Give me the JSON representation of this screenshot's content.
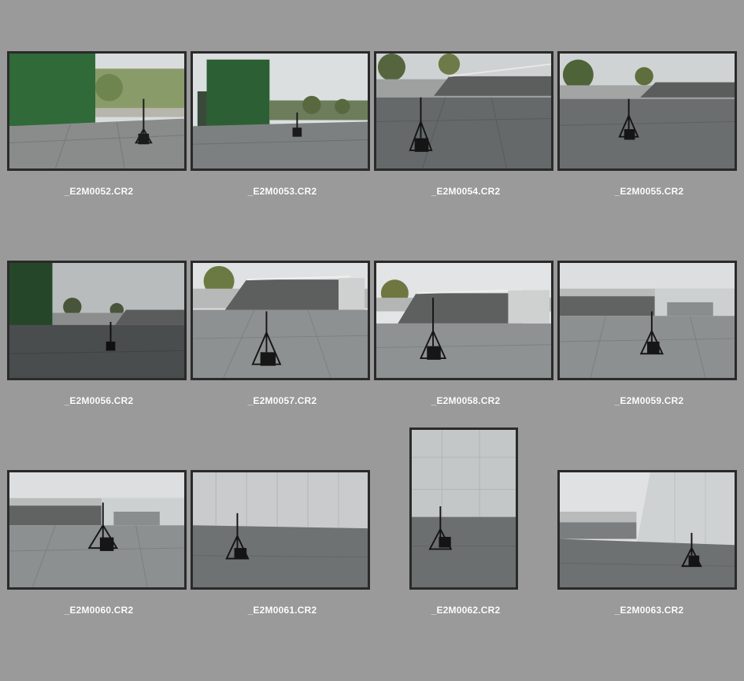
{
  "window": {
    "title": ""
  },
  "thumbnails": [
    {
      "filename": "_E2M0052.CR2",
      "orientation": "landscape",
      "scene": "green-shed"
    },
    {
      "filename": "_E2M0053.CR2",
      "orientation": "landscape",
      "scene": "green-shed"
    },
    {
      "filename": "_E2M0054.CR2",
      "orientation": "landscape",
      "scene": "stairs"
    },
    {
      "filename": "_E2M0055.CR2",
      "orientation": "landscape",
      "scene": "stairs"
    },
    {
      "filename": "_E2M0056.CR2",
      "orientation": "landscape",
      "scene": "green-shed"
    },
    {
      "filename": "_E2M0057.CR2",
      "orientation": "landscape",
      "scene": "stairs"
    },
    {
      "filename": "_E2M0058.CR2",
      "orientation": "landscape",
      "scene": "stairs"
    },
    {
      "filename": "_E2M0059.CR2",
      "orientation": "landscape",
      "scene": "terrace"
    },
    {
      "filename": "_E2M0060.CR2",
      "orientation": "landscape",
      "scene": "terrace"
    },
    {
      "filename": "_E2M0061.CR2",
      "orientation": "landscape",
      "scene": "wall"
    },
    {
      "filename": "_E2M0062.CR2",
      "orientation": "portrait",
      "scene": "wall"
    },
    {
      "filename": "_E2M0063.CR2",
      "orientation": "landscape",
      "scene": "wall-corner"
    }
  ],
  "colors": {
    "background": "#9a9a9a",
    "thumb_border": "#2a2a2a",
    "label": "#ffffff"
  }
}
